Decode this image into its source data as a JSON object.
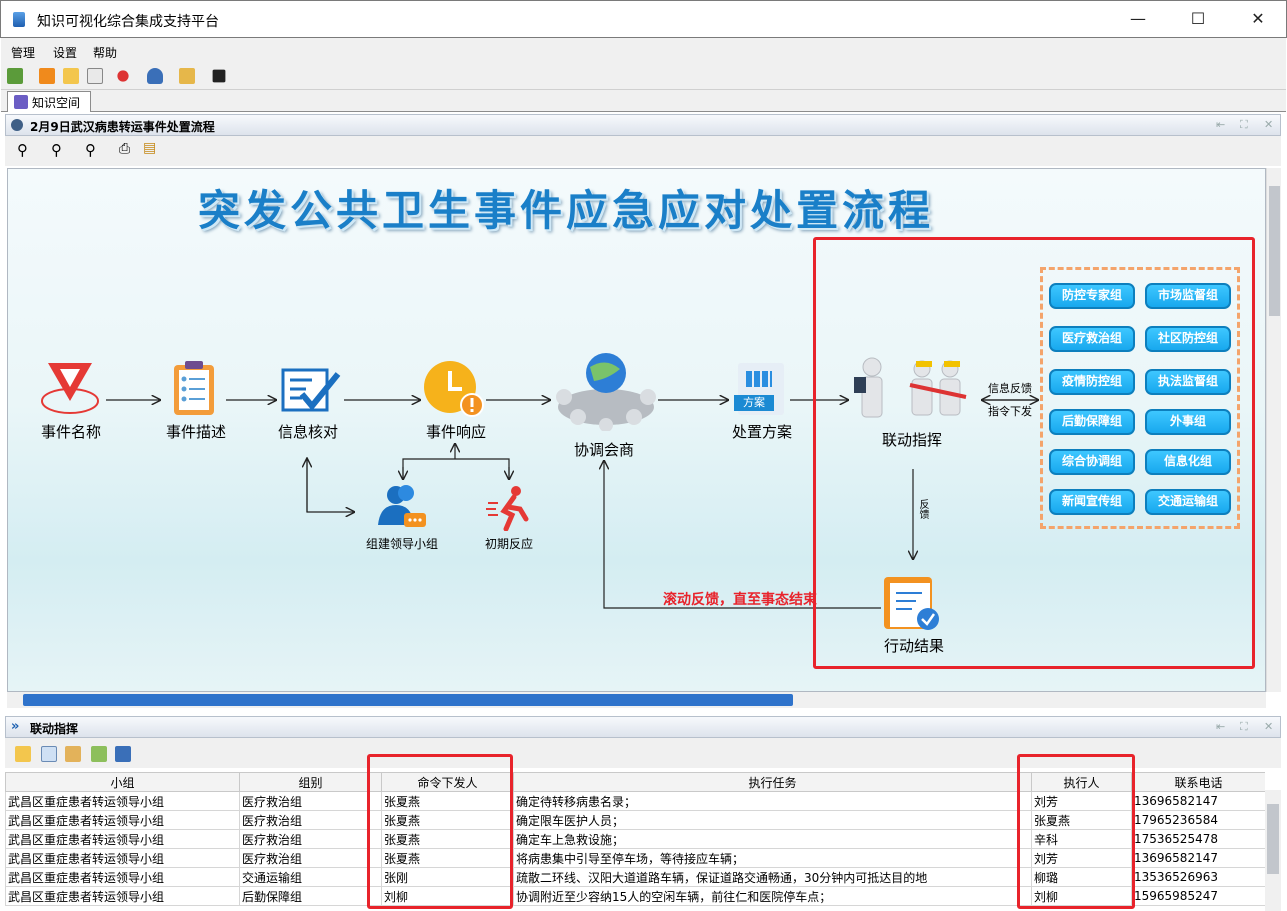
{
  "window": {
    "title": "知识可视化综合集成支持平台"
  },
  "menu": [
    "管理",
    "设置",
    "帮助"
  ],
  "tab": {
    "label": "知识空间"
  },
  "diagram_pane": {
    "title": "2月9日武汉病患转运事件处置流程"
  },
  "diagram": {
    "heading": "突发公共卫生事件应急应对处置流程",
    "nodes": {
      "event_name": "事件名称",
      "event_desc": "事件描述",
      "info_check": "信息核对",
      "event_response": "事件响应",
      "coordination": "协调会商",
      "plan": "处置方案",
      "plan_tag": "方案",
      "command": "联动指挥",
      "leader_group": "组建领导小组",
      "initial": "初期反应",
      "result": "行动结果"
    },
    "feedback_label": "滚动反馈，直至事态结束",
    "info_feedback": "信息反馈",
    "order_down": "指令下发",
    "vertical_label": "反馈",
    "groups": [
      "防控专家组",
      "市场监督组",
      "医疗救治组",
      "社区防控组",
      "疫情防控组",
      "执法监督组",
      "后勤保障组",
      "外事组",
      "综合协调组",
      "信息化组",
      "新闻宣传组",
      "交通运输组"
    ]
  },
  "lower_pane": {
    "title": "联动指挥"
  },
  "table": {
    "headers": [
      "小组",
      "组别",
      "命令下发人",
      "执行任务",
      "执行人",
      "联系电话"
    ],
    "rows": [
      [
        "武昌区重症患者转运领导小组",
        "医疗救治组",
        "张夏燕",
        "确定待转移病患名录；",
        "刘芳",
        "13696582147"
      ],
      [
        "武昌区重症患者转运领导小组",
        "医疗救治组",
        "张夏燕",
        "确定限车医护人员；",
        "张夏燕",
        "17965236584"
      ],
      [
        "武昌区重症患者转运领导小组",
        "医疗救治组",
        "张夏燕",
        "确定车上急救设施；",
        "辛科",
        "17536525478"
      ],
      [
        "武昌区重症患者转运领导小组",
        "医疗救治组",
        "张夏燕",
        "将病患集中引导至停车场，等待接应车辆；",
        "刘芳",
        "13696582147"
      ],
      [
        "武昌区重症患者转运领导小组",
        "交通运输组",
        "张刚",
        "疏散二环线、汉阳大道道路车辆，保证道路交通畅通，30分钟内可抵达目的地",
        "柳璐",
        "13536526963"
      ],
      [
        "武昌区重症患者转运领导小组",
        "后勤保障组",
        "刘柳",
        "协调附近至少容纳15人的空闲车辆，前往仁和医院停车点；",
        "刘柳",
        "15965985247"
      ]
    ]
  },
  "colors": {
    "accent": "#1a7fc8",
    "highlight": "#e8232b",
    "group_btn": "#22b2f4"
  }
}
